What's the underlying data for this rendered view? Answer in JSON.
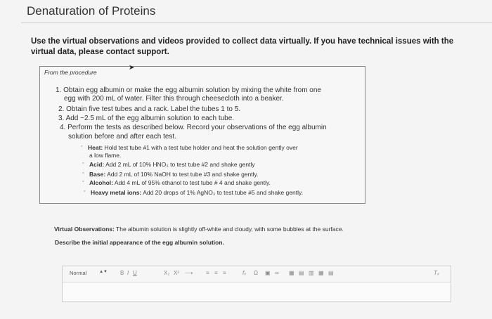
{
  "page": {
    "title": "Denaturation of Proteins",
    "instructions": "Use the virtual observations and videos provided to collect data virtually. If you have technical issues with the virtual data, please contact support."
  },
  "procedure": {
    "label": "From the procedure",
    "steps": [
      "1. Obtain egg albumin or make the egg albumin solution by mixing the white from one",
      "egg with 200 mL of water. Filter this through cheesecloth into a beaker.",
      "2. Obtain five test tubes and a rack. Label the tubes 1 to 5.",
      "3. Add ~2.5 mL of the egg albumin solution to each tube.",
      "4. Perform the tests as described below. Record your observations of the egg albumin",
      "solution before and after each test."
    ],
    "tests": [
      {
        "name": "Heat:",
        "text": "Hold test tube #1 with a test tube holder and heat the solution gently over",
        "text2": "a low flame."
      },
      {
        "name": "Acid:",
        "text": "Add 2 mL of 10% HNO₃ to test tube #2 and shake gently"
      },
      {
        "name": "Base:",
        "text": "Add 2 mL of 10% NaOH to test tube #3 and shake gently."
      },
      {
        "name": "Alcohol:",
        "text": "Add 4 mL of 95% ethanol to test tube # 4 and shake gently."
      },
      {
        "name": "Heavy metal ions:",
        "text": "Add 20 drops of 1% AgNO₃ to test tube #5 and shake gently."
      }
    ]
  },
  "observations": {
    "label": "Virtual Observations:",
    "text": "The albumin solution is slightly off-white and cloudy, with some bubbles at the surface."
  },
  "question": "Describe the initial appearance of the egg albumin solution.",
  "editor": {
    "style_select": "Normal",
    "toolbar_icons": [
      "bold-icon",
      "italic-icon",
      "underline-icon",
      "subscript-icon",
      "superscript-icon",
      "arrow-icon",
      "align-icon",
      "ordered-list-icon",
      "bullet-list-icon",
      "formula-icon",
      "omega-icon",
      "image-icon",
      "link-icon",
      "table-icon",
      "clear-format-icon"
    ],
    "text": ""
  }
}
